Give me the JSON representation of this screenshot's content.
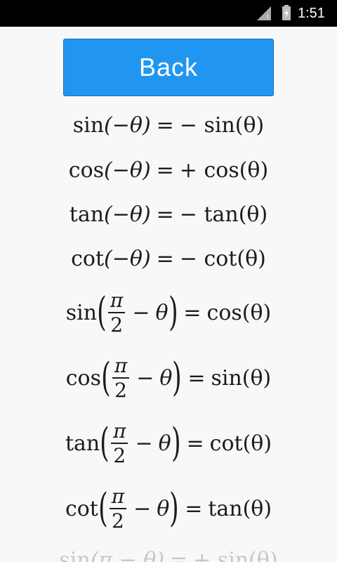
{
  "status_bar": {
    "time": "1:51",
    "icons": [
      "signal-icon",
      "battery-charging-icon"
    ]
  },
  "back_button": {
    "label": "Back",
    "color": "#2196f0"
  },
  "identities": [
    {
      "lhs_fn": "sin",
      "lhs_arg": "(−θ)",
      "rhs": "− sin(θ)"
    },
    {
      "lhs_fn": "cos",
      "lhs_arg": "(−θ)",
      "rhs": "+ cos(θ)"
    },
    {
      "lhs_fn": "tan",
      "lhs_arg": "(−θ)",
      "rhs": "− tan(θ)"
    },
    {
      "lhs_fn": "cot",
      "lhs_arg": "(−θ)",
      "rhs": "− cot(θ)"
    }
  ],
  "cofunction": [
    {
      "fn": "sin",
      "num": "π",
      "den": "2",
      "var": "θ",
      "rhs": "cos(θ)"
    },
    {
      "fn": "cos",
      "num": "π",
      "den": "2",
      "var": "θ",
      "rhs": "sin(θ)"
    },
    {
      "fn": "tan",
      "num": "π",
      "den": "2",
      "var": "θ",
      "rhs": "cot(θ)"
    },
    {
      "fn": "cot",
      "num": "π",
      "den": "2",
      "var": "θ",
      "rhs": "tan(θ)"
    }
  ],
  "partial_next": {
    "lhs_fn": "sin",
    "lhs_arg": "(π − θ)",
    "rhs": "+ sin(θ)"
  }
}
